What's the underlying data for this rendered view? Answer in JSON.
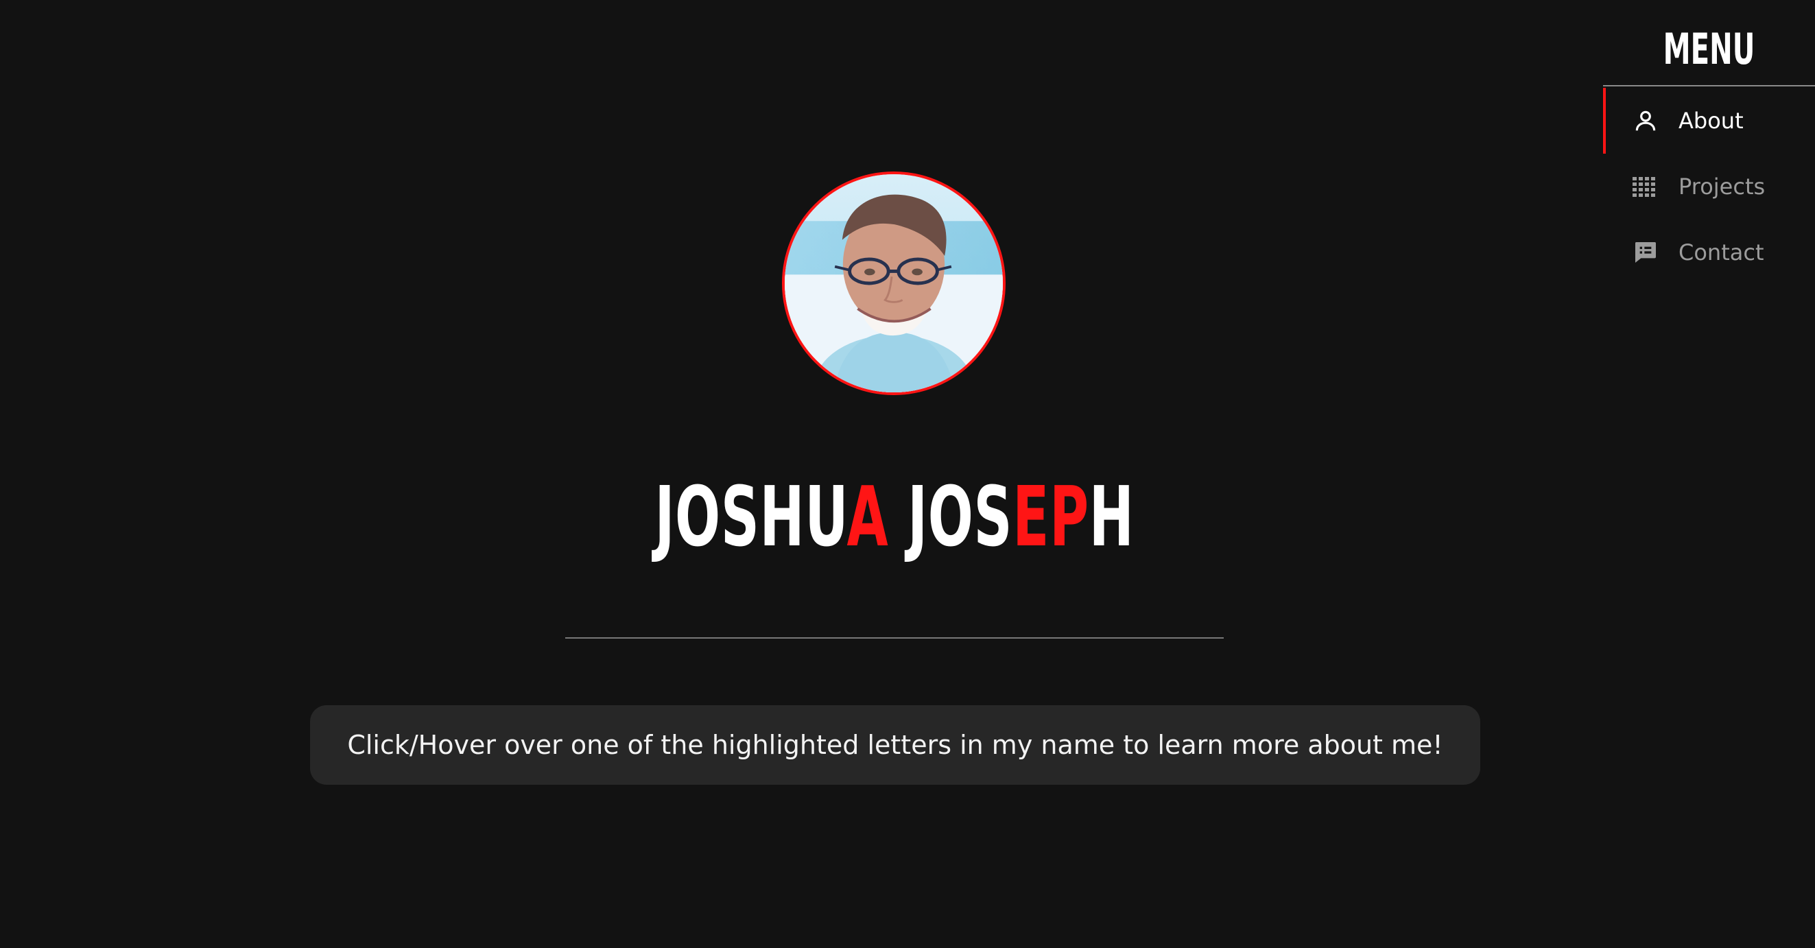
{
  "profile": {
    "photo_alt": "Profile photo"
  },
  "hero": {
    "name_parts": [
      {
        "text": "JOSHU",
        "highlight": false
      },
      {
        "text": "A",
        "highlight": true
      },
      {
        "text": " JOS",
        "highlight": false
      },
      {
        "text": "EP",
        "highlight": true
      },
      {
        "text": "H",
        "highlight": false
      }
    ]
  },
  "hint": {
    "text": "Click/Hover over one of the highlighted letters in my name to learn more about me!"
  },
  "menu": {
    "title": "MENU",
    "items": [
      {
        "label": "About",
        "icon": "person-icon",
        "active": true
      },
      {
        "label": "Projects",
        "icon": "grid-icon",
        "active": false
      },
      {
        "label": "Contact",
        "icon": "message-icon",
        "active": false
      }
    ]
  },
  "colors": {
    "background": "#121212",
    "accent": "#ff1515",
    "panel": "#272727",
    "text": "#ffffff",
    "muted": "#9c9c9c"
  }
}
